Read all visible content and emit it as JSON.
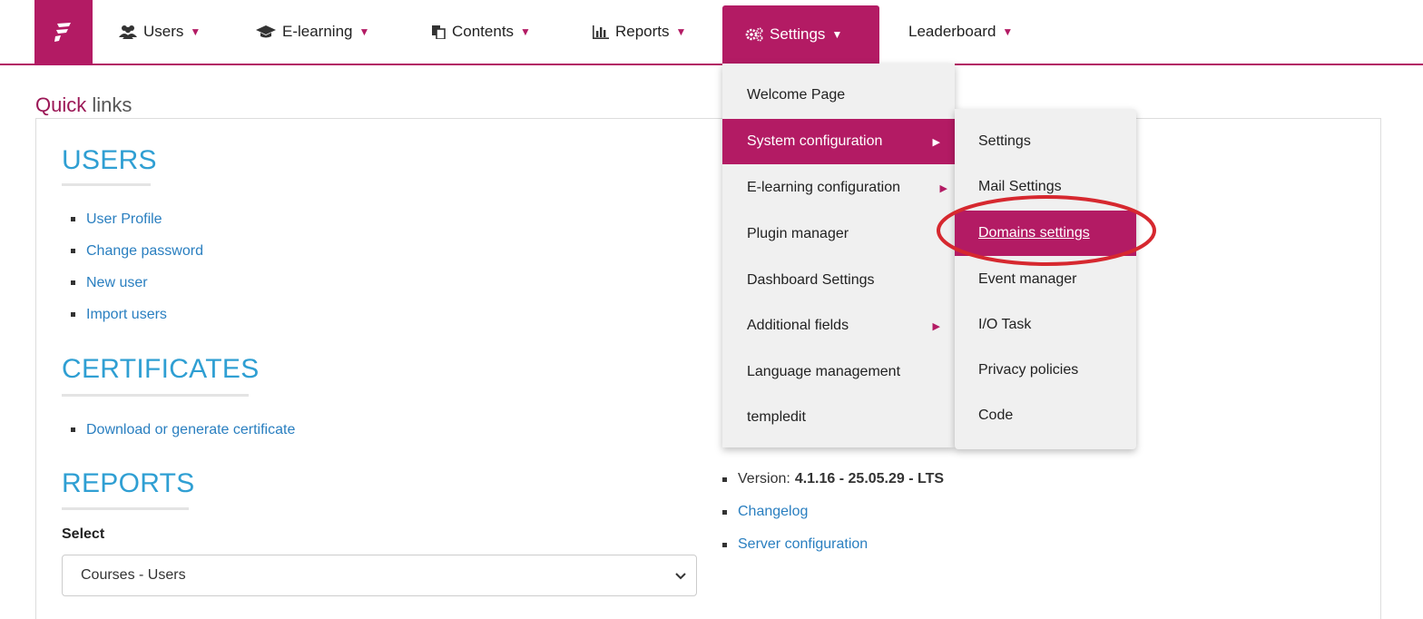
{
  "nav": {
    "items": [
      {
        "label": "Users",
        "icon": "users-icon"
      },
      {
        "label": "E-learning",
        "icon": "graduation-cap-icon"
      },
      {
        "label": "Contents",
        "icon": "copy-icon"
      },
      {
        "label": "Reports",
        "icon": "bar-chart-icon"
      },
      {
        "label": "Settings",
        "icon": "gears-icon",
        "active": true
      },
      {
        "label": "Leaderboard",
        "icon": ""
      }
    ]
  },
  "quick_links": {
    "title_accent": "Quick",
    "title_rest": " links",
    "users": {
      "heading": "USERS",
      "links": [
        "User Profile",
        "Change password",
        "New user",
        "Import users"
      ]
    },
    "certificates": {
      "heading": "CERTIFICATES",
      "links": [
        "Download or generate certificate"
      ]
    },
    "reports": {
      "heading": "REPORTS",
      "select_label": "Select",
      "select_value": "Courses - Users"
    },
    "info": {
      "version_label": "Version:",
      "version_value": "4.1.16 - 25.05.29 - LTS",
      "changelog": "Changelog",
      "server_configuration": "Server configuration"
    }
  },
  "settings_menu": {
    "items": [
      {
        "label": "Welcome Page",
        "has_submenu": false
      },
      {
        "label": "System configuration",
        "has_submenu": true,
        "highlighted": true
      },
      {
        "label": "E-learning configuration",
        "has_submenu": true
      },
      {
        "label": "Plugin manager",
        "has_submenu": false
      },
      {
        "label": "Dashboard Settings",
        "has_submenu": false
      },
      {
        "label": "Additional fields",
        "has_submenu": true
      },
      {
        "label": "Language management",
        "has_submenu": false
      },
      {
        "label": "templedit",
        "has_submenu": false
      }
    ]
  },
  "system_config_submenu": {
    "items": [
      {
        "label": "Settings"
      },
      {
        "label": "Mail Settings"
      },
      {
        "label": "Domains settings",
        "highlighted": true
      },
      {
        "label": "Event manager"
      },
      {
        "label": "I/O Task"
      },
      {
        "label": "Privacy policies"
      },
      {
        "label": "Code"
      }
    ]
  },
  "colors": {
    "brand": "#b31b64",
    "link": "#2a7fc0",
    "section_heading": "#2f9fd3",
    "annotation": "#d6282f"
  }
}
